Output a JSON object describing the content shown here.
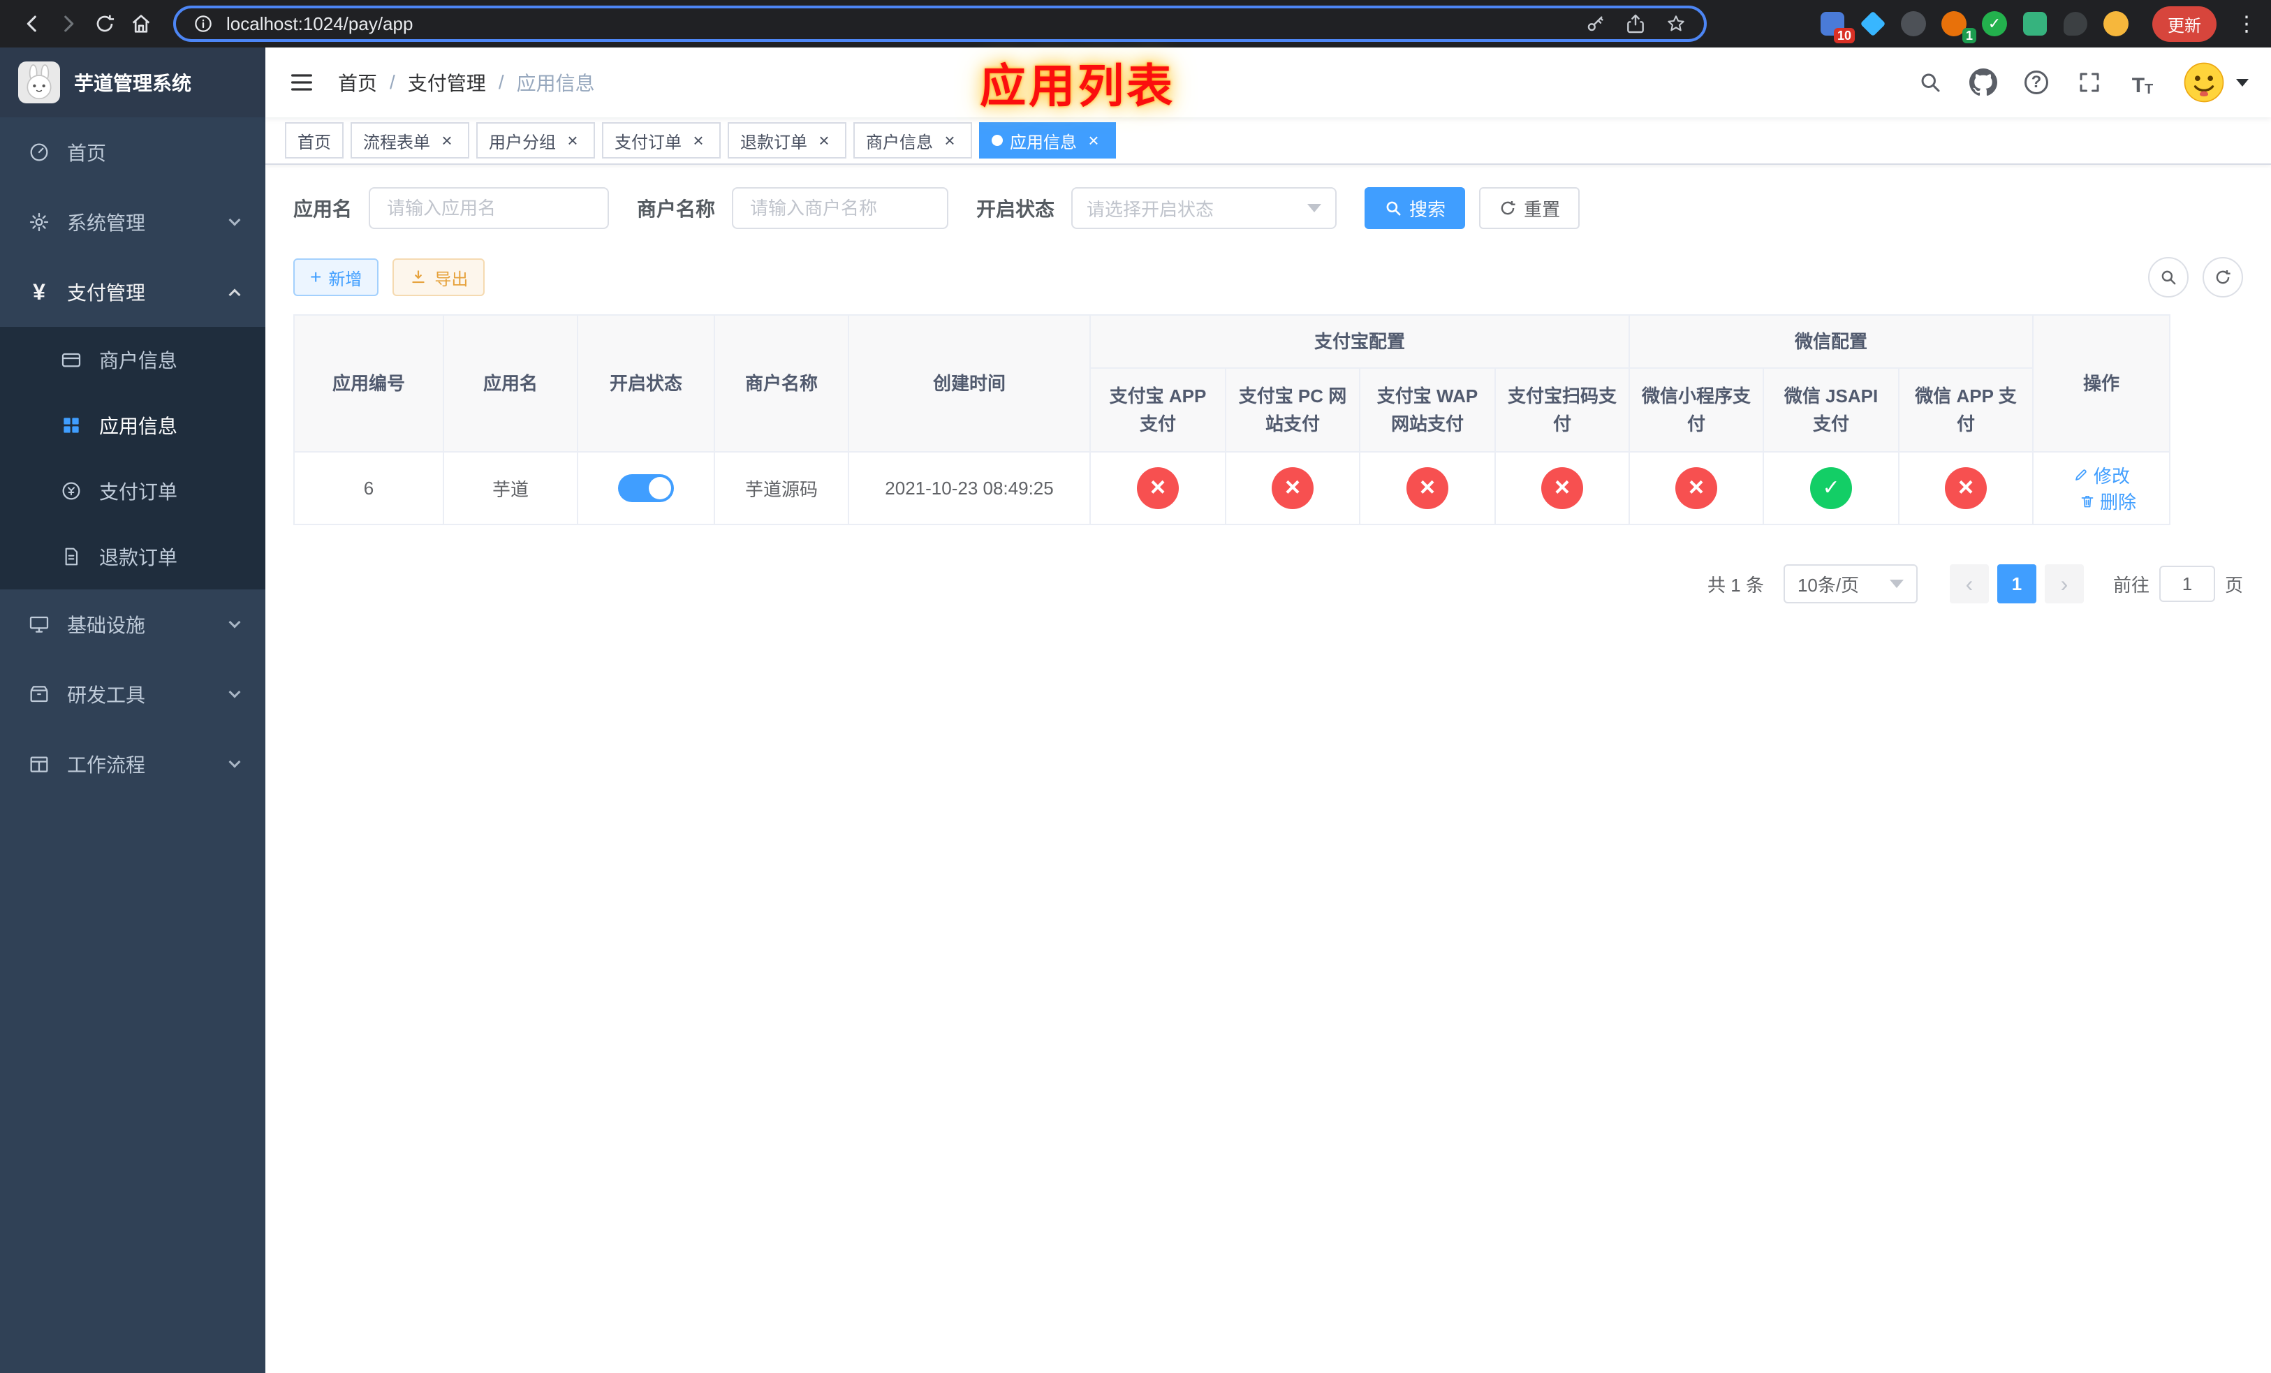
{
  "colors": {
    "primary": "#409eff",
    "success_circle": "#13ce66",
    "danger_circle": "#f75050",
    "warning": "#e6a23c",
    "sidebar_bg": "#304156",
    "submenu_bg": "#1f2d3d",
    "update_button_bg": "#d7453c",
    "annotation_red": "#fb0e0e"
  },
  "browser": {
    "url": "localhost:1024/pay/app",
    "update_label": "更新",
    "extension_badge_1": "10",
    "extension_badge_2": "1"
  },
  "sidebar": {
    "title": "芋道管理系统",
    "items": [
      {
        "label": "首页"
      },
      {
        "label": "系统管理"
      },
      {
        "label": "支付管理"
      },
      {
        "label": "基础设施"
      },
      {
        "label": "研发工具"
      },
      {
        "label": "工作流程"
      }
    ],
    "payment_children": [
      {
        "label": "商户信息"
      },
      {
        "label": "应用信息"
      },
      {
        "label": "支付订单"
      },
      {
        "label": "退款订单"
      }
    ]
  },
  "header": {
    "breadcrumb": [
      {
        "label": "首页"
      },
      {
        "label": "支付管理"
      },
      {
        "label": "应用信息"
      }
    ],
    "annotation": "应用列表"
  },
  "tabs": [
    {
      "label": "首页"
    },
    {
      "label": "流程表单"
    },
    {
      "label": "用户分组"
    },
    {
      "label": "支付订单"
    },
    {
      "label": "退款订单"
    },
    {
      "label": "商户信息"
    },
    {
      "label": "应用信息"
    }
  ],
  "filter": {
    "app_name": {
      "label": "应用名",
      "placeholder": "请输入应用名",
      "value": ""
    },
    "merchant_name": {
      "label": "商户名称",
      "placeholder": "请输入商户名称",
      "value": ""
    },
    "status": {
      "label": "开启状态",
      "placeholder": "请选择开启状态"
    },
    "search_label": "搜索",
    "reset_label": "重置"
  },
  "toolbar": {
    "add_label": "新增",
    "export_label": "导出"
  },
  "table": {
    "groups": {
      "alipay": "支付宝配置",
      "wechat": "微信配置"
    },
    "columns": [
      "应用编号",
      "应用名",
      "开启状态",
      "商户名称",
      "创建时间",
      "支付宝 APP 支付",
      "支付宝 PC 网站支付",
      "支付宝 WAP 网站支付",
      "支付宝扫码支付",
      "微信小程序支付",
      "微信 JSAPI 支付",
      "微信 APP 支付",
      "操作"
    ],
    "rows": [
      {
        "id": "6",
        "name": "芋道",
        "status": "on",
        "merchant": "芋道源码",
        "created_at": "2021-10-23 08:49:25",
        "configs": [
          "fail",
          "fail",
          "fail",
          "fail",
          "fail",
          "pass",
          "fail"
        ],
        "edit_label": "修改",
        "delete_label": "删除"
      }
    ]
  },
  "pagination": {
    "total": "共 1 条",
    "page_size": "10条/页",
    "current_page": "1",
    "goto_prefix": "前往",
    "goto_value": "1",
    "goto_suffix": "页"
  }
}
